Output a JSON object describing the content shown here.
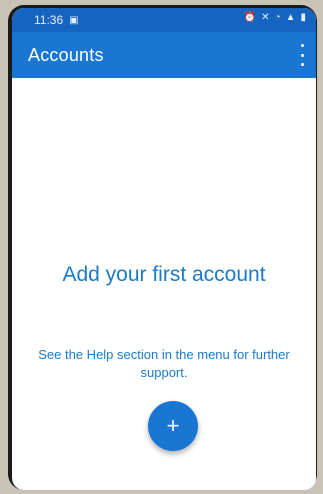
{
  "status_bar": {
    "time": "11:36",
    "icons": [
      "image-notification-icon",
      "alarm-icon",
      "mute-icon",
      "wifi-icon",
      "signal-icon",
      "battery-icon"
    ]
  },
  "app_bar": {
    "title": "Accounts",
    "menu_icon": "more-vert-icon"
  },
  "empty_state": {
    "headline": "Add your first account",
    "help_text": "See the Help section in the menu for further support."
  },
  "fab": {
    "label": "+",
    "icon": "plus-icon"
  },
  "colors": {
    "primary": "#1976d2",
    "status_bar": "#1565c0",
    "accent_text": "#1c7bc9"
  }
}
